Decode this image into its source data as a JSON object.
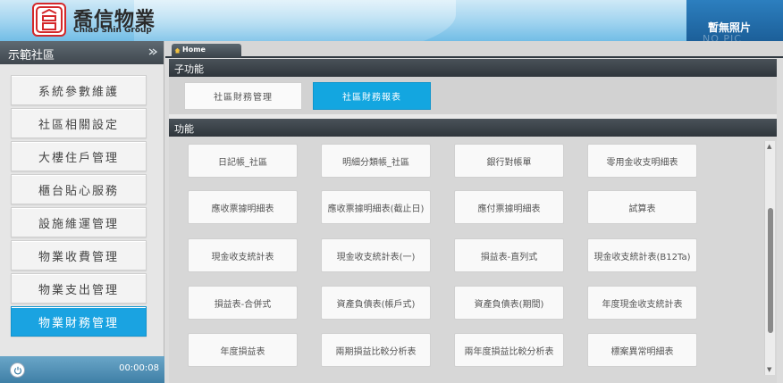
{
  "header": {
    "brand_cn": "喬信物業",
    "brand_en": "Chiao Shin Group",
    "photo_label": "暫無照片",
    "photo_sub": "NO PIC"
  },
  "sidebar": {
    "title": "示範社區",
    "items": [
      {
        "label": "系統參數維護"
      },
      {
        "label": "社區相關設定"
      },
      {
        "label": "大樓住戶管理"
      },
      {
        "label": "櫃台貼心服務"
      },
      {
        "label": "設施維運管理"
      },
      {
        "label": "物業收費管理"
      },
      {
        "label": "物業支出管理"
      },
      {
        "label": "物業財務管理"
      }
    ],
    "timer": "00:00:08"
  },
  "tabs": {
    "home": "Home"
  },
  "subfunc": {
    "title": "子功能",
    "buttons": [
      {
        "label": "社區財務管理"
      },
      {
        "label": "社區財務報表"
      }
    ]
  },
  "functions": {
    "title": "功能",
    "buttons": [
      {
        "label": "日記帳_社區"
      },
      {
        "label": "明細分類帳_社區"
      },
      {
        "label": "銀行對帳單"
      },
      {
        "label": "零用金收支明細表"
      },
      {
        "label": "應收票據明細表"
      },
      {
        "label": "應收票據明細表(截止日)"
      },
      {
        "label": "應付票據明細表"
      },
      {
        "label": "試算表"
      },
      {
        "label": "現金收支統計表"
      },
      {
        "label": "現金收支統計表(一)"
      },
      {
        "label": "損益表-直列式"
      },
      {
        "label": "現金收支統計表(B12Ta)"
      },
      {
        "label": "損益表-合併式"
      },
      {
        "label": "資產負債表(帳戶式)"
      },
      {
        "label": "資產負債表(期間)"
      },
      {
        "label": "年度現金收支統計表"
      },
      {
        "label": "年度損益表"
      },
      {
        "label": "兩期損益比較分析表"
      },
      {
        "label": "兩年度損益比較分析表"
      },
      {
        "label": "標案異常明細表"
      }
    ]
  },
  "colors": {
    "accent": "#1aa3e1",
    "header_dark": "#2f363c"
  }
}
